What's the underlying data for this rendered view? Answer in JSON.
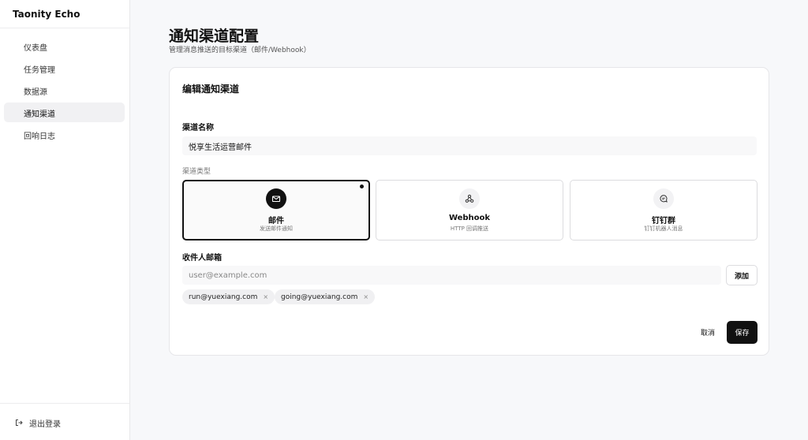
{
  "sidebar": {
    "brand": "Taonity Echo",
    "items": [
      {
        "label": "仪表盘"
      },
      {
        "label": "任务管理"
      },
      {
        "label": "数据源"
      },
      {
        "label": "通知渠道"
      },
      {
        "label": "回响日志"
      }
    ],
    "active_index": 3,
    "logout_label": "退出登录"
  },
  "header": {
    "title": "通知渠道配置",
    "subtitle": "管理消息推送的目标渠道（邮件/Webhook）"
  },
  "form": {
    "title": "编辑通知渠道",
    "name_label": "渠道名称",
    "name_value": "悦享生活运营邮件",
    "type_label": "渠道类型",
    "types": [
      {
        "name": "邮件",
        "desc": "发送邮件通知",
        "icon": "mail-icon"
      },
      {
        "name": "Webhook",
        "desc": "HTTP 回调推送",
        "icon": "webhook-icon"
      },
      {
        "name": "钉钉群",
        "desc": "钉钉机器人消息",
        "icon": "chat-icon"
      }
    ],
    "selected_type_index": 0,
    "recipients_label": "收件人邮箱",
    "email_placeholder": "user@example.com",
    "add_label": "添加",
    "recipients": [
      "run@yuexiang.com",
      "going@yuexiang.com"
    ],
    "remove_symbol": "×",
    "cancel_label": "取消",
    "save_label": "保存"
  },
  "colors": {
    "accent": "#111111",
    "background": "#f7f8fa",
    "surface": "#ffffff"
  }
}
